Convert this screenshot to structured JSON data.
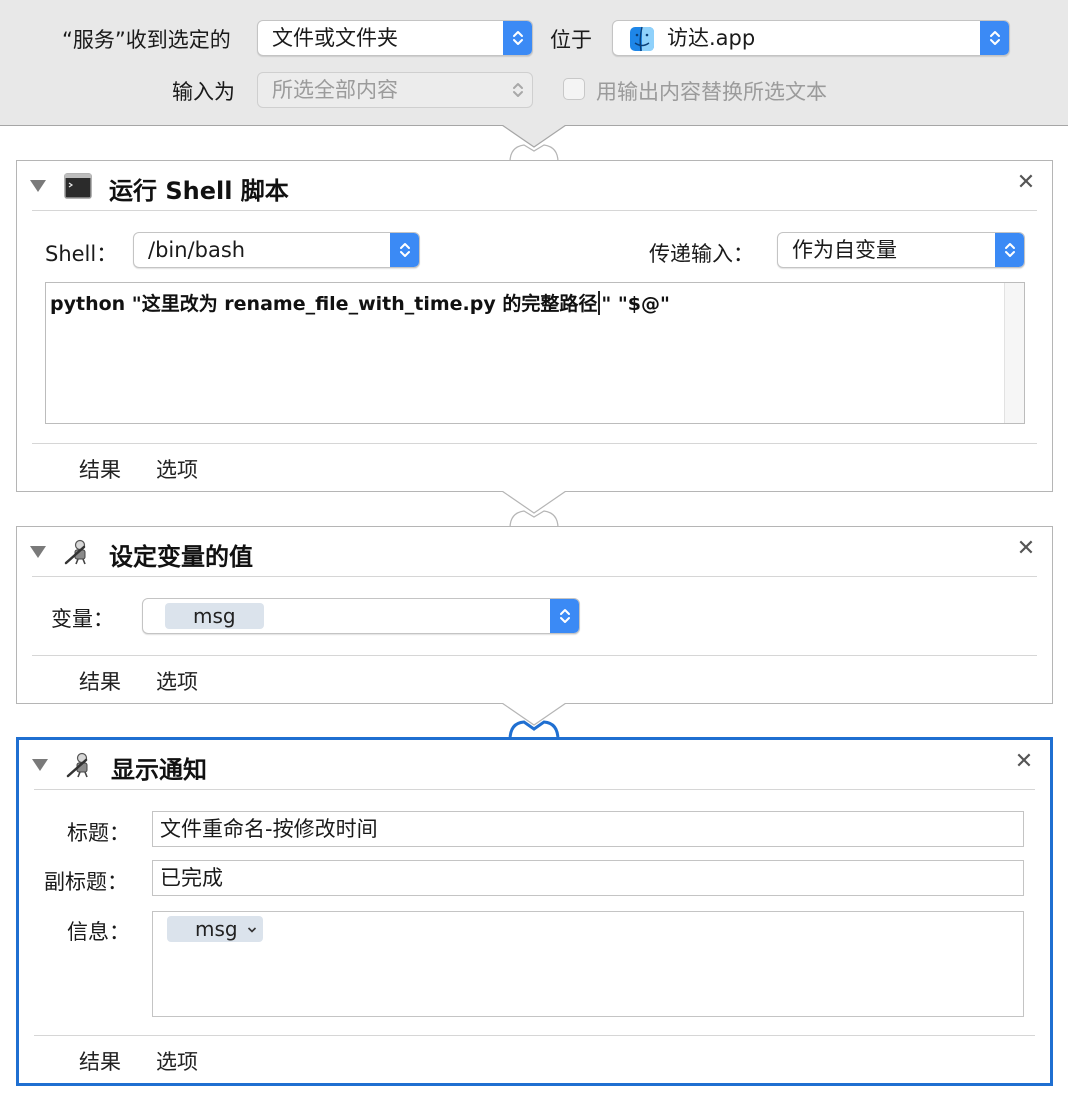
{
  "header": {
    "service_label": "“服务”收到选定的",
    "input_type_value": "文件或文件夹",
    "location_label": "位于",
    "location_value": "访达.app",
    "input_as_label": "输入为",
    "input_as_value": "所选全部内容",
    "replace_checkbox_label": "用输出内容替换所选文本",
    "replace_checked": false
  },
  "actions": [
    {
      "title": "运行 Shell 脚本",
      "icon": "terminal-icon",
      "shell_label": "Shell：",
      "shell_value": "/bin/bash",
      "pass_input_label": "传递输入：",
      "pass_input_value": "作为自变量",
      "script_before_caret": "python \"这里改为 rename_file_with_time.py 的完整路径",
      "script_after_caret": "\" \"$@\"",
      "tab_results": "结果",
      "tab_options": "选项"
    },
    {
      "title": "设定变量的值",
      "icon": "automator-robot-icon",
      "variable_label": "变量：",
      "variable_value": "msg",
      "tab_results": "结果",
      "tab_options": "选项"
    },
    {
      "title": "显示通知",
      "icon": "automator-robot-icon",
      "title_label": "标题：",
      "title_value": "文件重命名-按修改时间",
      "subtitle_label": "副标题：",
      "subtitle_value": "已完成",
      "message_label": "信息：",
      "message_token": "msg",
      "tab_results": "结果",
      "tab_options": "选项"
    }
  ],
  "colors": {
    "accent": "#3b8af5",
    "selection_border": "#1f6fd1",
    "header_bg": "#e8e8e8",
    "token_bg": "#dbe3ec"
  }
}
